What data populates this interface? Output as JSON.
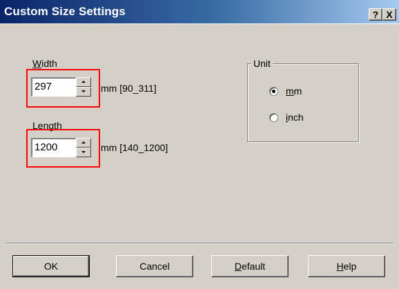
{
  "dialog": {
    "title": "Custom Size Settings",
    "help_button": "?",
    "close_button": "X"
  },
  "width": {
    "label_key": "W",
    "label_rest": "idth",
    "value": "297",
    "range": "mm [90_311]"
  },
  "length": {
    "label_key": "L",
    "label_rest": "ength",
    "value": "1200",
    "range": "mm [140_1200]"
  },
  "unit": {
    "title": "Unit",
    "options": [
      {
        "key": "m",
        "rest": "m",
        "selected": true
      },
      {
        "key": "i",
        "rest": "nch",
        "selected": false
      }
    ]
  },
  "buttons": {
    "ok": "OK",
    "cancel": "Cancel",
    "default_key": "D",
    "default_rest": "efault",
    "help_key": "H",
    "help_rest": "elp"
  },
  "colors": {
    "title_bar_start": "#0a246a",
    "dialog_face": "#d4d0c8",
    "highlight": "#ff0000"
  }
}
